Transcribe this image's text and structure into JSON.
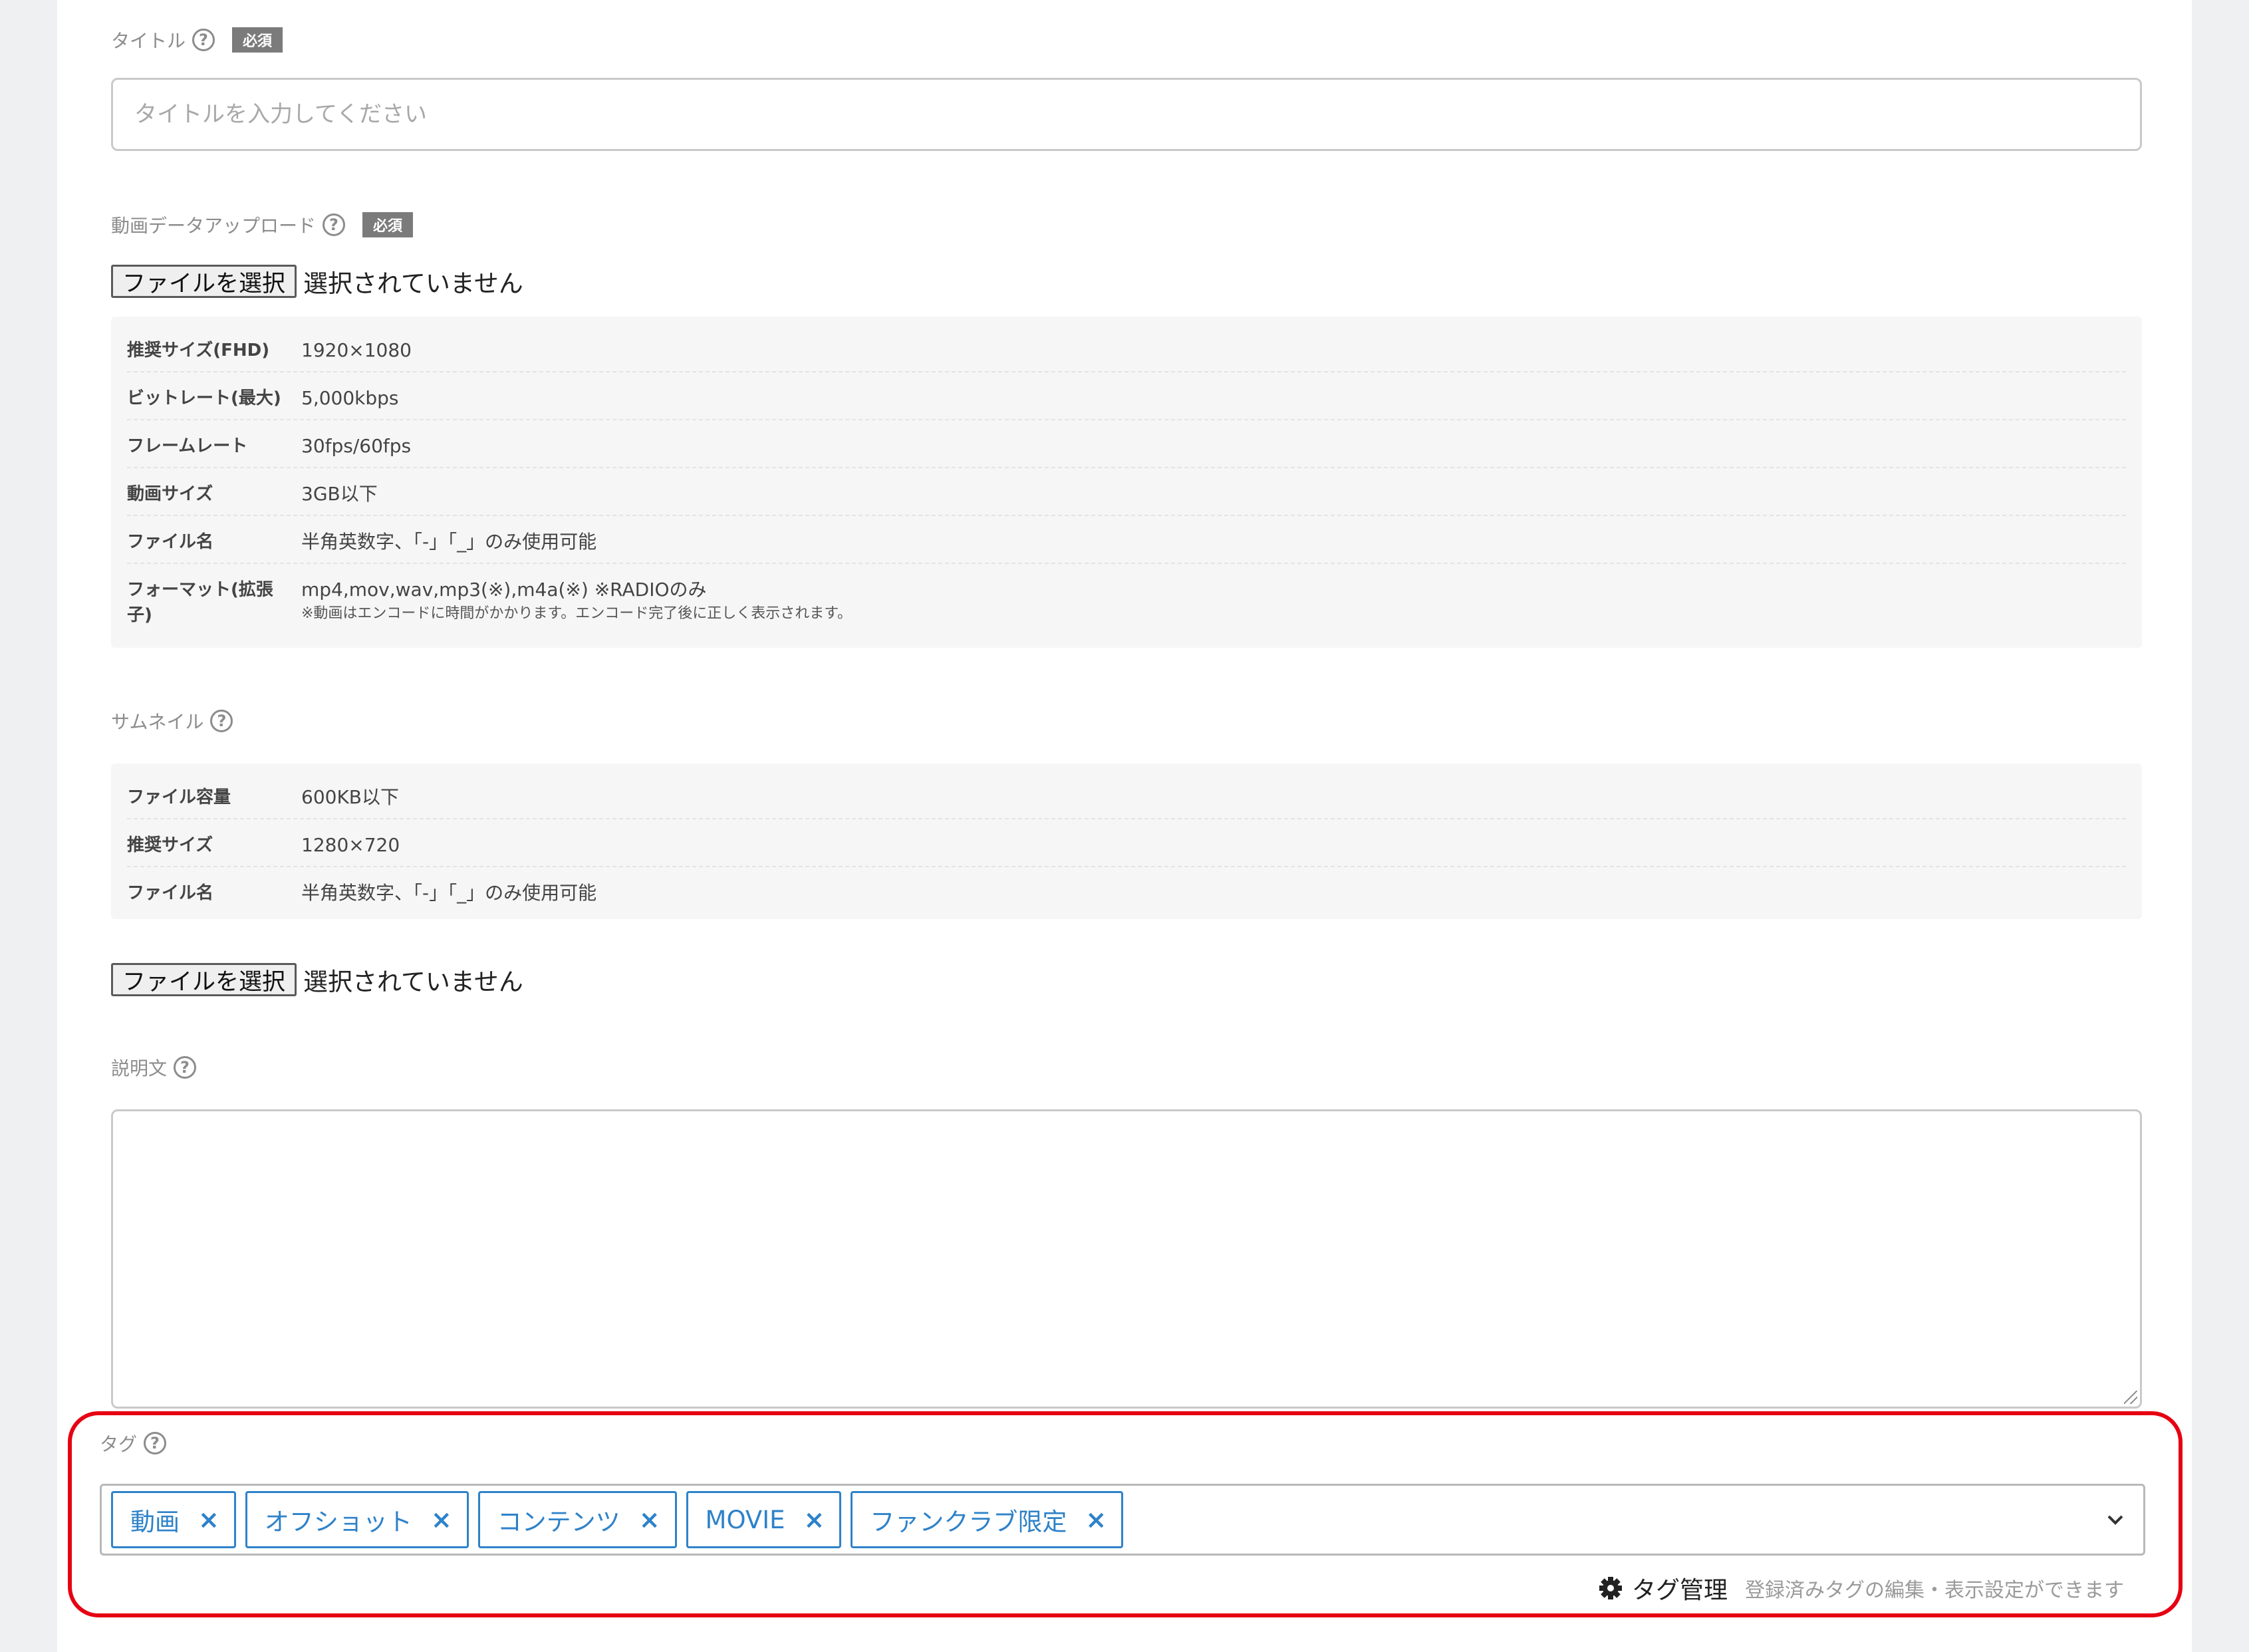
{
  "title_field": {
    "label": "タイトル",
    "help": "?",
    "required": "必須",
    "placeholder": "タイトルを入力してください"
  },
  "video_upload": {
    "label": "動画データアップロード",
    "help": "?",
    "required": "必須",
    "button": "ファイルを選択",
    "status": "選択されていません",
    "specs": [
      {
        "key": "推奨サイズ(FHD)",
        "value": "1920×1080"
      },
      {
        "key": "ビットレート(最大)",
        "value": "5,000kbps"
      },
      {
        "key": "フレームレート",
        "value": "30fps/60fps"
      },
      {
        "key": "動画サイズ",
        "value": "3GB以下"
      },
      {
        "key": "ファイル名",
        "value": "半角英数字、「-」「_」のみ使用可能"
      },
      {
        "key": "フォーマット(拡張子)",
        "value": "mp4,mov,wav,mp3(※),m4a(※) ※RADIOのみ",
        "note": "※動画はエンコードに時間がかかります。エンコード完了後に正しく表示されます。"
      }
    ]
  },
  "thumbnail": {
    "label": "サムネイル",
    "help": "?",
    "specs": [
      {
        "key": "ファイル容量",
        "value": "600KB以下"
      },
      {
        "key": "推奨サイズ",
        "value": "1280×720"
      },
      {
        "key": "ファイル名",
        "value": "半角英数字、「-」「_」のみ使用可能"
      }
    ],
    "button": "ファイルを選択",
    "status": "選択されていません"
  },
  "description": {
    "label": "説明文",
    "help": "?"
  },
  "tags": {
    "label": "タグ",
    "help": "?",
    "items": [
      {
        "label": "動画",
        "remove": "×"
      },
      {
        "label": "オフショット",
        "remove": "×"
      },
      {
        "label": "コンテンツ",
        "remove": "×"
      },
      {
        "label": "MOVIE",
        "remove": "×"
      },
      {
        "label": "ファンクラブ限定",
        "remove": "×"
      }
    ],
    "manage_label": "タグ管理",
    "manage_description": "登録済みタグの編集・表示設定ができます"
  },
  "colors": {
    "tag_accent": "#2e82c9",
    "highlight": "#e60012",
    "required_badge": "#7b7b7b"
  }
}
